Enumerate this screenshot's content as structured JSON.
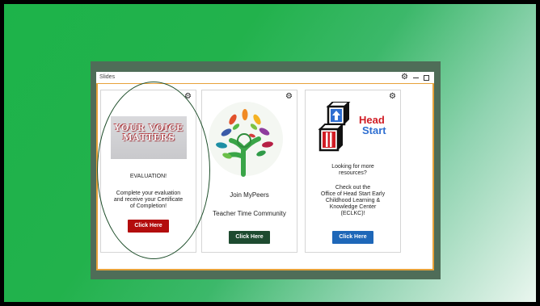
{
  "window": {
    "title": "Slides"
  },
  "cards": [
    {
      "image_text": [
        "YOUR VOICE",
        "MATTERS"
      ],
      "heading": "EVALUATION!",
      "body": [
        "Complete your evaluation",
        "and receive your Certificate",
        "of Completion!"
      ],
      "button": "Click Here"
    },
    {
      "line1": "Join MyPeers",
      "line2": "Teacher Time Community",
      "button": "Click Here"
    },
    {
      "logo_text": [
        "Head",
        "Start"
      ],
      "body1": [
        "Looking for more",
        "resources?"
      ],
      "body2": [
        "Check out the",
        "Office of Head Start Early",
        "Childhood Learning &",
        "Knowledge Center",
        "(ECLKC)!"
      ],
      "button": "Click Here"
    }
  ],
  "icons": {
    "titlebar": [
      "gear-icon",
      "minimize-icon",
      "maximize-icon"
    ],
    "card": "gear-icon"
  },
  "colors": {
    "frame_border": "#e8a23a",
    "button_red": "#b30d0d",
    "button_green": "#1e4b30",
    "button_blue": "#1e67b8",
    "oval": "#1f4f2b"
  }
}
